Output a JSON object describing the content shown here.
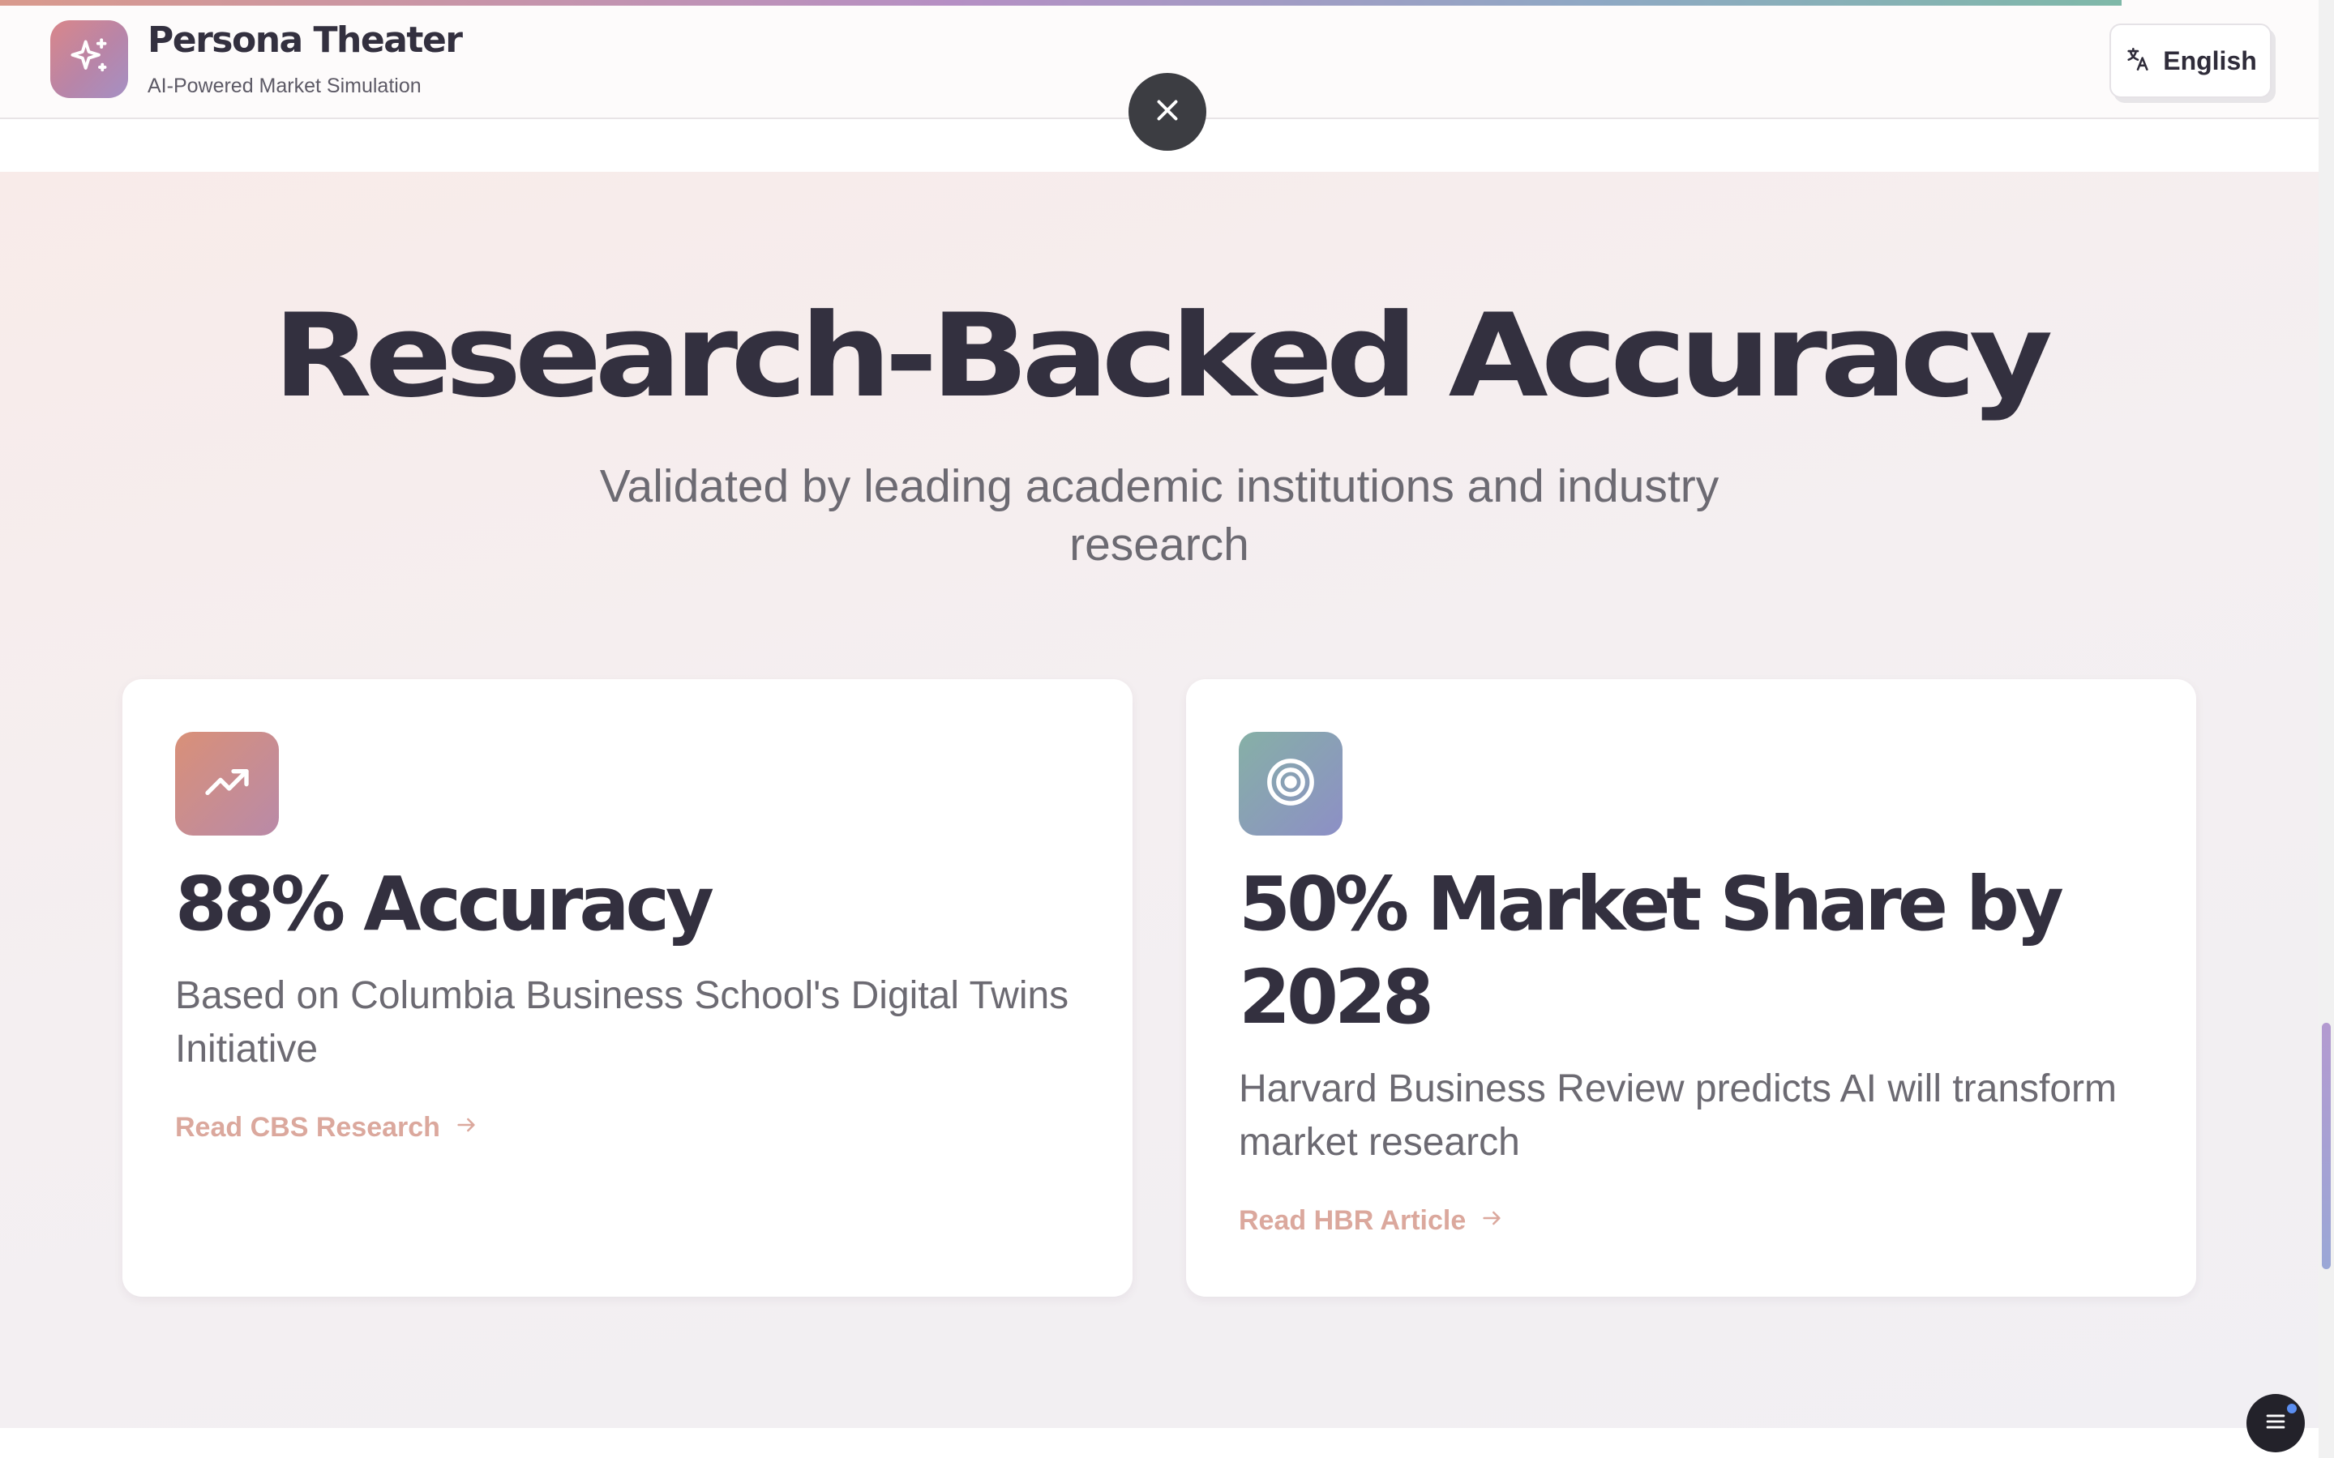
{
  "progress": {
    "fraction": 0.915
  },
  "header": {
    "brand_name": "Persona Theater",
    "tagline": "AI-Powered Market Simulation",
    "logo_icon": "sparkles-icon",
    "language_label": "English",
    "language_icon": "translate-icon"
  },
  "close_icon": "close-icon",
  "section": {
    "title": "Research-Backed Accuracy",
    "subtitle": "Validated by leading academic institutions and industry research"
  },
  "cards": [
    {
      "icon": "trending-up-icon",
      "title": "88% Accuracy",
      "description": "Based on Columbia Business School's Digital Twins Initiative",
      "link_label": "Read CBS Research"
    },
    {
      "icon": "target-icon",
      "title": "50% Market Share by 2028",
      "description": "Harvard Business Review predicts AI will transform market research",
      "link_label": "Read HBR Article"
    }
  ],
  "menu_icon": "menu-icon",
  "colors": {
    "accent_link": "#dba89d",
    "heading": "#33303f",
    "body_text": "#6c6a72"
  }
}
